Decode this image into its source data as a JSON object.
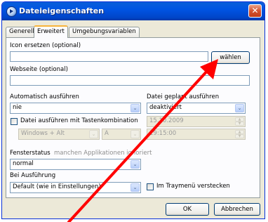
{
  "window": {
    "title": "Dateieigenschaften",
    "close_glyph": "✕"
  },
  "tabs": [
    {
      "label": "Generell",
      "active": false
    },
    {
      "label": "Erweitert",
      "active": true
    },
    {
      "label": "Umgebungsvariablen",
      "active": false
    }
  ],
  "icon": {
    "label": "Icon ersetzen (optional)",
    "value": "",
    "button": "wählen"
  },
  "website": {
    "label": "Webseite (optional)",
    "value": ""
  },
  "autorun": {
    "label": "Automatisch ausführen",
    "value": "nie"
  },
  "scheduled": {
    "label": "Datei geplant ausführen",
    "value": "deaktiviert",
    "date": "15.10.2009",
    "time": "19:15:00"
  },
  "hotkey": {
    "checkbox_label": "Datei ausführen mit Tastenkombination",
    "modifier": "Windows + Alt",
    "key": "A"
  },
  "window_state": {
    "label": "Fensterstatus",
    "hint": "manchen Applikationen ignoriert",
    "value": "normal"
  },
  "on_run": {
    "label": "Bei Ausführung",
    "value": "Default (wie in Einstellungen)"
  },
  "tray": {
    "label": "Im Traymenü verstecken"
  },
  "footer": {
    "ok": "OK",
    "cancel": "Abbrechen"
  },
  "dropdown_glyph": "⌄",
  "colors": {
    "title_bar": "#0054e3",
    "close_button": "#d5532f",
    "annotation_arrow": "#ff0000"
  }
}
